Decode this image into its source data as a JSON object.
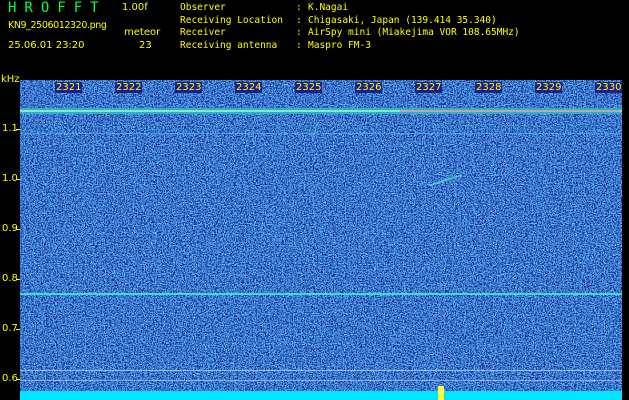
{
  "header": {
    "app_title": "HROFFT",
    "version": "1.00f",
    "filename": "KN9_2506012320.png",
    "datetime": "25.06.01 23:20",
    "meteor_label": "meteor",
    "meteor_count": "23",
    "info": [
      {
        "key": "Observer",
        "value": "K.Nagai"
      },
      {
        "key": "Receiving Location",
        "value": "Chigasaki, Japan (139.414 35.340)"
      },
      {
        "key": "Receiver",
        "value": "AirSpy mini (Miakejima VOR 108.65MHz)"
      },
      {
        "key": "Receiving antenna",
        "value": "Maspro FM-3"
      }
    ],
    "colon": ":"
  },
  "axes": {
    "y_unit": "kHz",
    "y_ticks": [
      "1.1",
      "1.0",
      "0.9",
      "0.8",
      "0.7",
      "0.6"
    ],
    "x_ticks": [
      "2321",
      "2322",
      "2323",
      "2324",
      "2325",
      "2326",
      "2327",
      "2328",
      "2329",
      "2330"
    ]
  },
  "colors": {
    "background": "#000000",
    "text": "#ffff00",
    "title": "#00ff4d",
    "waterfall_base": "#1a1f8a",
    "noise_bright": "#20a0e0",
    "carrier": "#40e0d0",
    "bottom_band": "#00e5ff"
  }
}
